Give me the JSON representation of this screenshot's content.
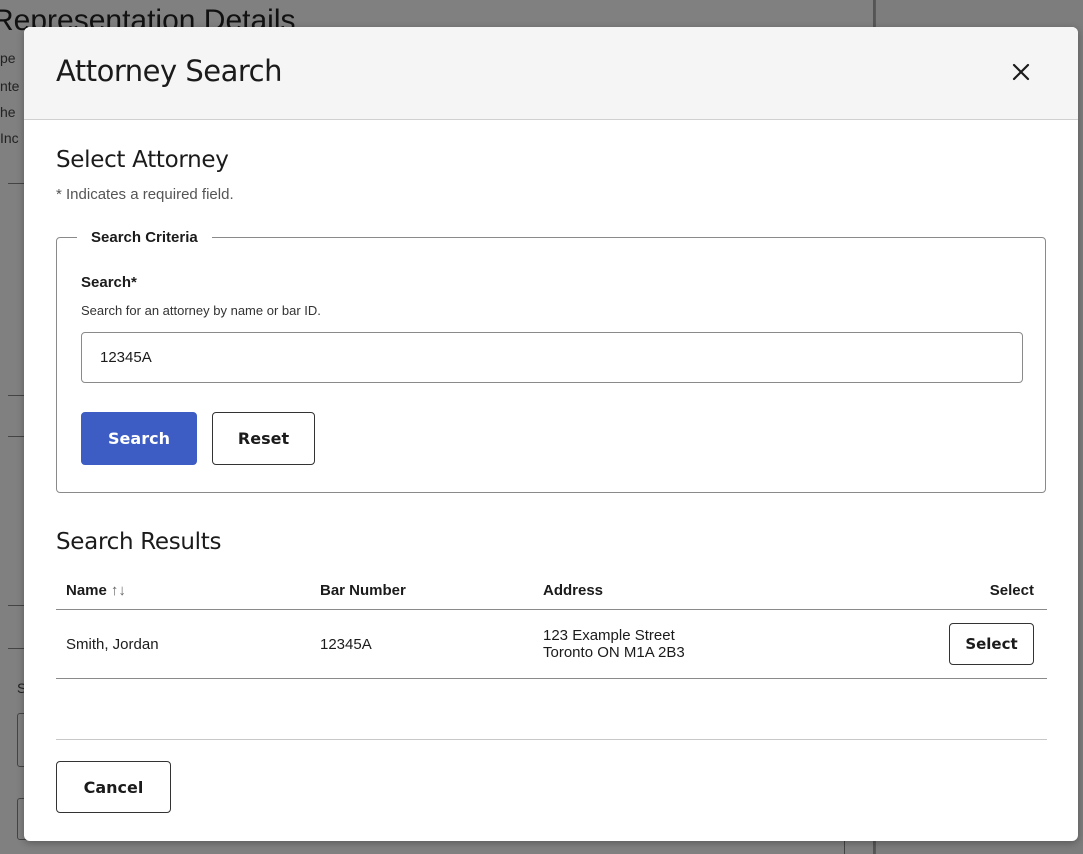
{
  "background": {
    "heading": "Representation Details",
    "lines": [
      "pe",
      "nte",
      "he",
      "Inc"
    ],
    "partial_label": "S"
  },
  "modal": {
    "title": "Attorney Search",
    "close_icon": "close-icon"
  },
  "select_section": {
    "title": "Select Attorney",
    "required_note": "* Indicates a required field."
  },
  "criteria": {
    "legend": "Search Criteria",
    "search_label": "Search*",
    "search_hint": "Search for an attorney by name or bar ID.",
    "search_value": "12345A",
    "search_button": "Search",
    "reset_button": "Reset"
  },
  "results": {
    "title": "Search Results",
    "columns": {
      "name": "Name",
      "bar_number": "Bar Number",
      "address": "Address",
      "select": "Select"
    },
    "sort_icon": "↑↓",
    "rows": [
      {
        "name": "Smith, Jordan",
        "bar_number": "12345A",
        "address_line1": "123 Example Street",
        "address_line2": "Toronto ON M1A 2B3",
        "select_label": "Select"
      }
    ]
  },
  "footer": {
    "cancel_button": "Cancel"
  },
  "colors": {
    "primary": "#3d5cc4",
    "overlay": "#808080"
  }
}
